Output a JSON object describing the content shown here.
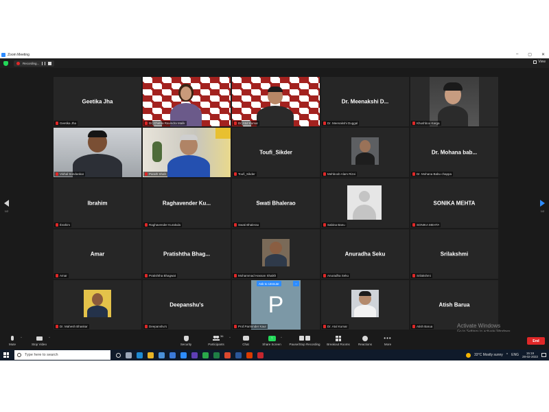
{
  "window": {
    "title": "Zoom Meeting",
    "controls": [
      "–",
      "▢",
      "✕"
    ]
  },
  "topbar": {
    "recording_label": "Recording...",
    "view_label": "View"
  },
  "paging": {
    "left_label": "1/2",
    "right_label": "1/2"
  },
  "tiles": [
    {
      "big": "Geetika Jha",
      "caption": "Geetika Jha"
    },
    {
      "big": "",
      "caption": "Dr. Chetna Ravindra Malik"
    },
    {
      "big": "",
      "caption": "Dr. Atul Kumar"
    },
    {
      "big": "Dr. Meenakshi D...",
      "caption": "Dr. Meenakshi Duggal"
    },
    {
      "big": "",
      "caption": "Khushboo Karga"
    },
    {
      "big": "",
      "caption": "Vishal Sondankar"
    },
    {
      "big": "",
      "caption": "Parath Shah"
    },
    {
      "big": "Toufi_Sikder",
      "caption": "Toufi_Sikder"
    },
    {
      "big": "",
      "caption": "Mehboob Alam Rizvi"
    },
    {
      "big": "Dr. Mohana bab...",
      "caption": "Dr. Mohana Babu chappa"
    },
    {
      "big": "Ibrahim",
      "caption": "Ibrahim"
    },
    {
      "big": "Raghavender Ku...",
      "caption": "Raghavender Kurakula"
    },
    {
      "big": "Swati Bhalerao",
      "caption": "Swati Bhalerao"
    },
    {
      "big": "",
      "caption": "Sabina Banu"
    },
    {
      "big": "SONIKA MEHTA",
      "caption": "SONIKA MEHTA"
    },
    {
      "big": "Amar",
      "caption": "Amar"
    },
    {
      "big": "Pratishtha Bhag...",
      "caption": "Pratishtha Bhagwat"
    },
    {
      "big": "",
      "caption": "Mohammad Hassan Shaikh"
    },
    {
      "big": "Anuradha Seku",
      "caption": "Anuradha Seku"
    },
    {
      "big": "Srilakshmi",
      "caption": "Srilakshmi"
    },
    {
      "big": "",
      "caption": "Dr. Mahesh Bhaskar"
    },
    {
      "big": "Deepanshu's",
      "caption": "Deepanshu's"
    },
    {
      "big": "P",
      "caption": "Prof.Parminder Kaur"
    },
    {
      "big": "",
      "caption": "Dr. Atul Kumar"
    },
    {
      "big": "Atish Barua",
      "caption": "Atish Barua"
    }
  ],
  "unmute_tip": {
    "label": "Ask to Unmute",
    "more": "..."
  },
  "watermark": {
    "line1": "Activate Windows",
    "line2": "Go to Settings to activate Windows."
  },
  "toolbar": {
    "mute": "Mute",
    "stop_video": "Stop Video",
    "security": "Security",
    "participants": "Participants",
    "participants_count": "36",
    "chat": "Chat",
    "share_screen": "Share Screen",
    "pause_stop_recording": "Pause/Stop Recording",
    "breakout_rooms": "Breakout Rooms",
    "reactions": "Reactions",
    "more": "More",
    "end": "End"
  },
  "taskbar": {
    "search_placeholder": "Type here to search",
    "weather": "33°C  Mostly sunny",
    "lang": "ENG",
    "time": "15:19",
    "date": "28-02-2022"
  },
  "colors": {
    "accent_blue": "#2d8cff",
    "talking_outline": "#c7e000",
    "share_green": "#23d959",
    "end_red": "#e02828",
    "banner_red": "#a3221f"
  }
}
